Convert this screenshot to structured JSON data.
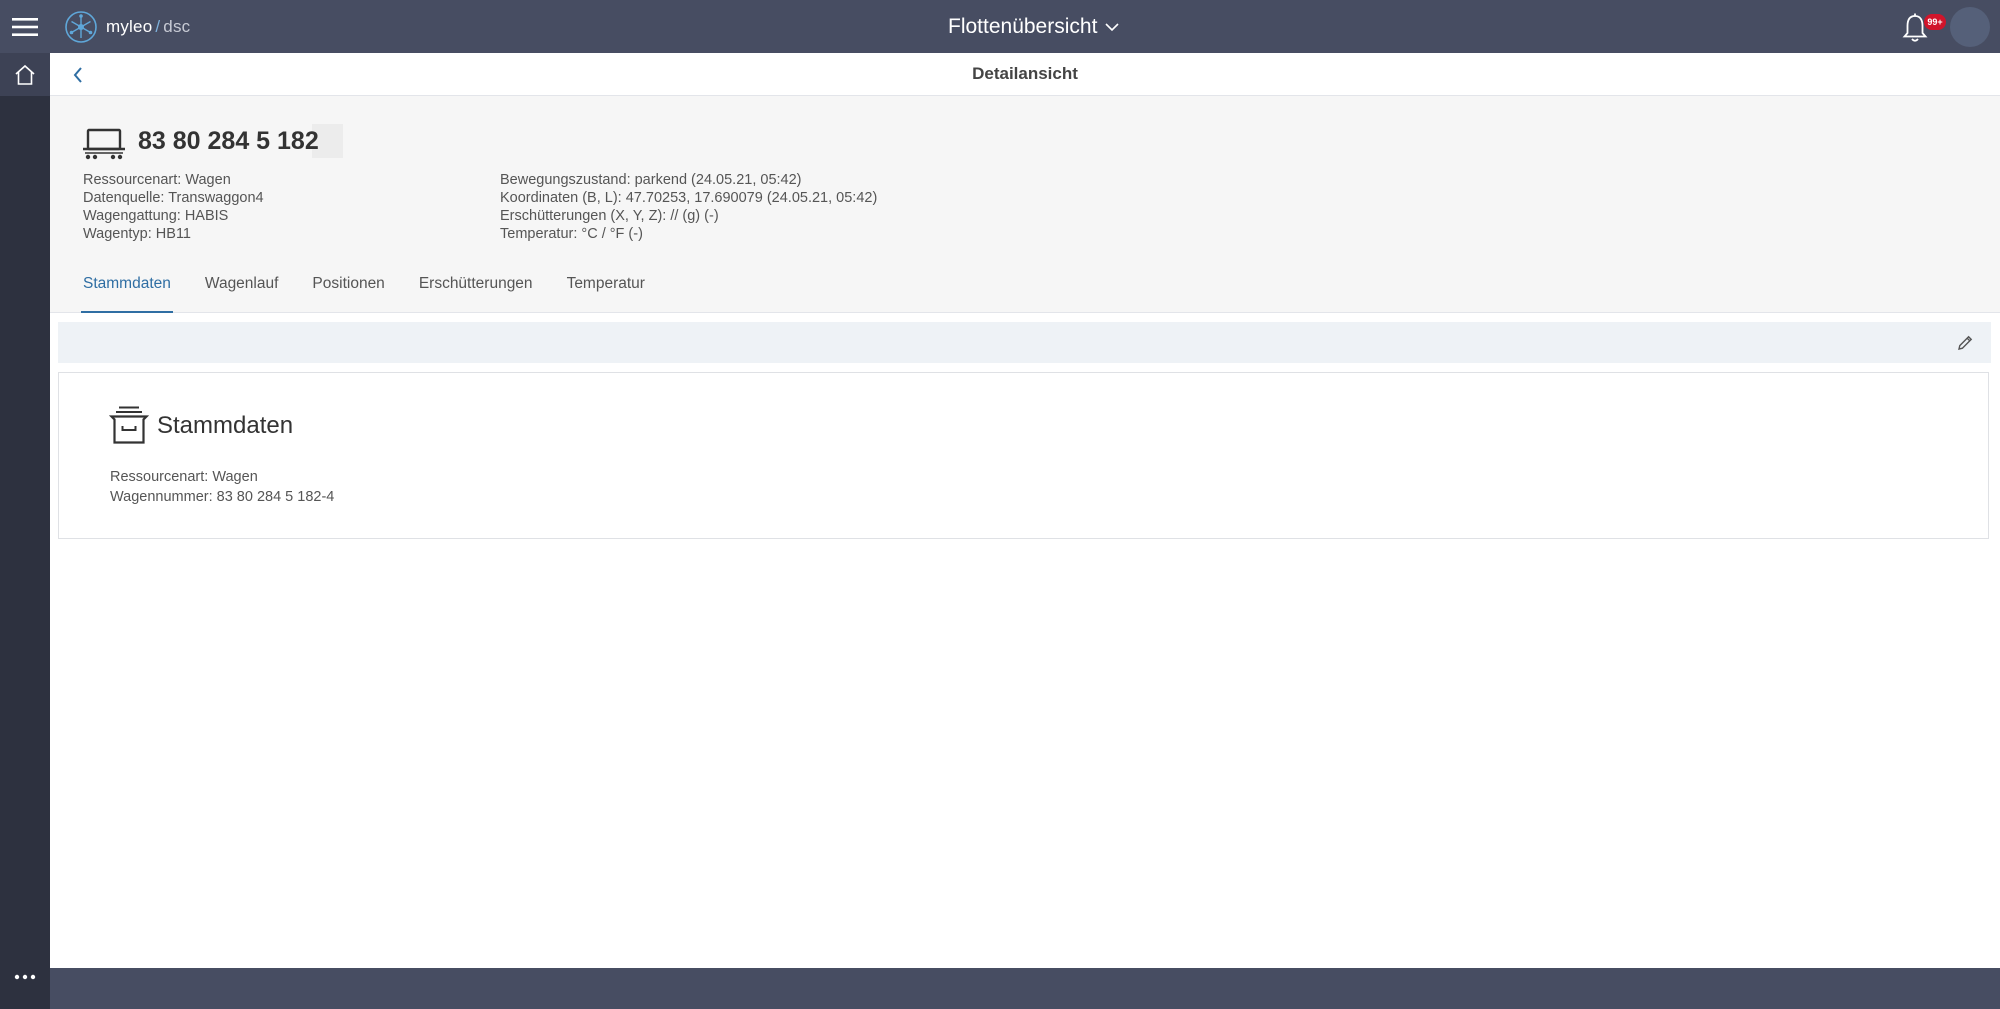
{
  "app": {
    "logo_main": "myleo",
    "logo_sep": "/",
    "logo_sub": "dsc",
    "view_title": "Flottenübersicht",
    "notification_badge": "99+"
  },
  "subheader": {
    "title": "Detailansicht"
  },
  "resource": {
    "id": "83 80 284 5 182",
    "left_info": [
      "Ressourcenart: Wagen",
      "Datenquelle: Transwaggon4",
      "Wagengattung: HABIS",
      "Wagentyp: HB11"
    ],
    "right_info": [
      "Bewegungszustand: parkend (24.05.21, 05:42)",
      "Koordinaten (B, L): 47.70253, 17.690079 (24.05.21, 05:42)",
      "Erschütterungen (X, Y, Z): // (g) (-)",
      "Temperatur: °C / °F (-)"
    ]
  },
  "tabs": [
    {
      "label": "Stammdaten",
      "active": true
    },
    {
      "label": "Wagenlauf",
      "active": false
    },
    {
      "label": "Positionen",
      "active": false
    },
    {
      "label": "Erschütterungen",
      "active": false
    },
    {
      "label": "Temperatur",
      "active": false
    }
  ],
  "card": {
    "title": "Stammdaten",
    "lines": [
      "Ressourcenart: Wagen",
      "Wagennummer: 83 80 284 5 182-4"
    ]
  },
  "colors": {
    "topbar": "#474d62",
    "rail": "#2d313f",
    "accent": "#2f6ea3",
    "badge": "#d1152b"
  }
}
